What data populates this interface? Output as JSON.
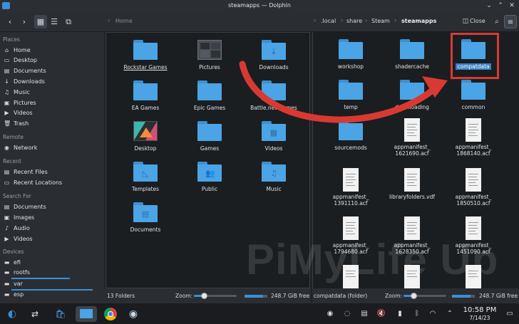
{
  "window": {
    "title": "steamapps — Dolphin"
  },
  "toolbar": {
    "left_crumb": "Home",
    "crumbs": [
      ".local",
      "share",
      "Steam",
      "steamapps"
    ],
    "close_label": "Close"
  },
  "sidebar": {
    "places_heading": "Places",
    "places": [
      {
        "label": "Home",
        "icon": "home-icon"
      },
      {
        "label": "Desktop",
        "icon": "desktop-icon"
      },
      {
        "label": "Documents",
        "icon": "documents-icon"
      },
      {
        "label": "Downloads",
        "icon": "downloads-icon"
      },
      {
        "label": "Music",
        "icon": "music-icon"
      },
      {
        "label": "Pictures",
        "icon": "pictures-icon"
      },
      {
        "label": "Videos",
        "icon": "videos-icon"
      },
      {
        "label": "Trash",
        "icon": "trash-icon"
      }
    ],
    "remote_heading": "Remote",
    "remote": [
      {
        "label": "Network",
        "icon": "network-icon"
      }
    ],
    "recent_heading": "Recent",
    "recent": [
      {
        "label": "Recent Files",
        "icon": "recent-files-icon"
      },
      {
        "label": "Recent Locations",
        "icon": "recent-locations-icon"
      }
    ],
    "search_heading": "Search For",
    "search": [
      {
        "label": "Documents",
        "icon": "documents-icon"
      },
      {
        "label": "Images",
        "icon": "images-icon"
      },
      {
        "label": "Audio",
        "icon": "audio-icon"
      },
      {
        "label": "Videos",
        "icon": "videos-icon"
      }
    ],
    "devices_heading": "Devices",
    "devices": [
      {
        "label": "efi",
        "icon": "drive-icon"
      },
      {
        "label": "rootfs",
        "icon": "drive-icon"
      },
      {
        "label": "var",
        "icon": "drive-icon"
      },
      {
        "label": "esp",
        "icon": "drive-icon"
      }
    ]
  },
  "left_pane": {
    "items": [
      {
        "label": "Rockstar Games",
        "kind": "folder"
      },
      {
        "label": "Pictures",
        "kind": "picture-folder"
      },
      {
        "label": "Downloads",
        "kind": "folder-download"
      },
      {
        "label": "EA Games",
        "kind": "folder"
      },
      {
        "label": "Epic Games",
        "kind": "folder"
      },
      {
        "label": "Battle.net Games",
        "kind": "folder"
      },
      {
        "label": "Desktop",
        "kind": "desktop-folder"
      },
      {
        "label": "Games",
        "kind": "folder"
      },
      {
        "label": "Videos",
        "kind": "folder-videos"
      },
      {
        "label": "Templates",
        "kind": "folder-templates"
      },
      {
        "label": "Public",
        "kind": "folder-public"
      },
      {
        "label": "Music",
        "kind": "folder-music"
      },
      {
        "label": "Documents",
        "kind": "folder-documents"
      }
    ],
    "status": "13 Folders",
    "zoom_label": "Zoom:",
    "free": "248.7 GiB free"
  },
  "right_pane": {
    "items": [
      {
        "label": "workshop",
        "kind": "folder"
      },
      {
        "label": "shadercache",
        "kind": "folder"
      },
      {
        "label": "compatdata",
        "kind": "folder",
        "selected": true
      },
      {
        "label": "temp",
        "kind": "folder"
      },
      {
        "label": "downloading",
        "kind": "folder"
      },
      {
        "label": "common",
        "kind": "folder"
      },
      {
        "label": "sourcemods",
        "kind": "folder"
      },
      {
        "label": "appmanifest_\n1621690.acf",
        "kind": "file"
      },
      {
        "label": "appmanifest_\n1868140.acf",
        "kind": "file"
      },
      {
        "label": "appmanifest_\n1391110.acf",
        "kind": "file"
      },
      {
        "label": "libraryfolders.vdf",
        "kind": "file"
      },
      {
        "label": "appmanifest_\n1850510.acf",
        "kind": "file"
      },
      {
        "label": "appmanifest_\n1794680.acf",
        "kind": "file"
      },
      {
        "label": "appmanifest_\n1628350.acf",
        "kind": "file"
      },
      {
        "label": "appmanifest_\n1451090.acf",
        "kind": "file"
      }
    ],
    "status": "compatdata (folder)",
    "zoom_label": "Zoom:",
    "free": "248.7 GiB free"
  },
  "taskbar": {
    "time": "10:58 PM",
    "date": "7/14/23"
  },
  "watermark": "PiMyLife Up",
  "colors": {
    "accent": "#3a8fd8",
    "annotation": "#d83a33",
    "folder": "#4ba4e6"
  }
}
